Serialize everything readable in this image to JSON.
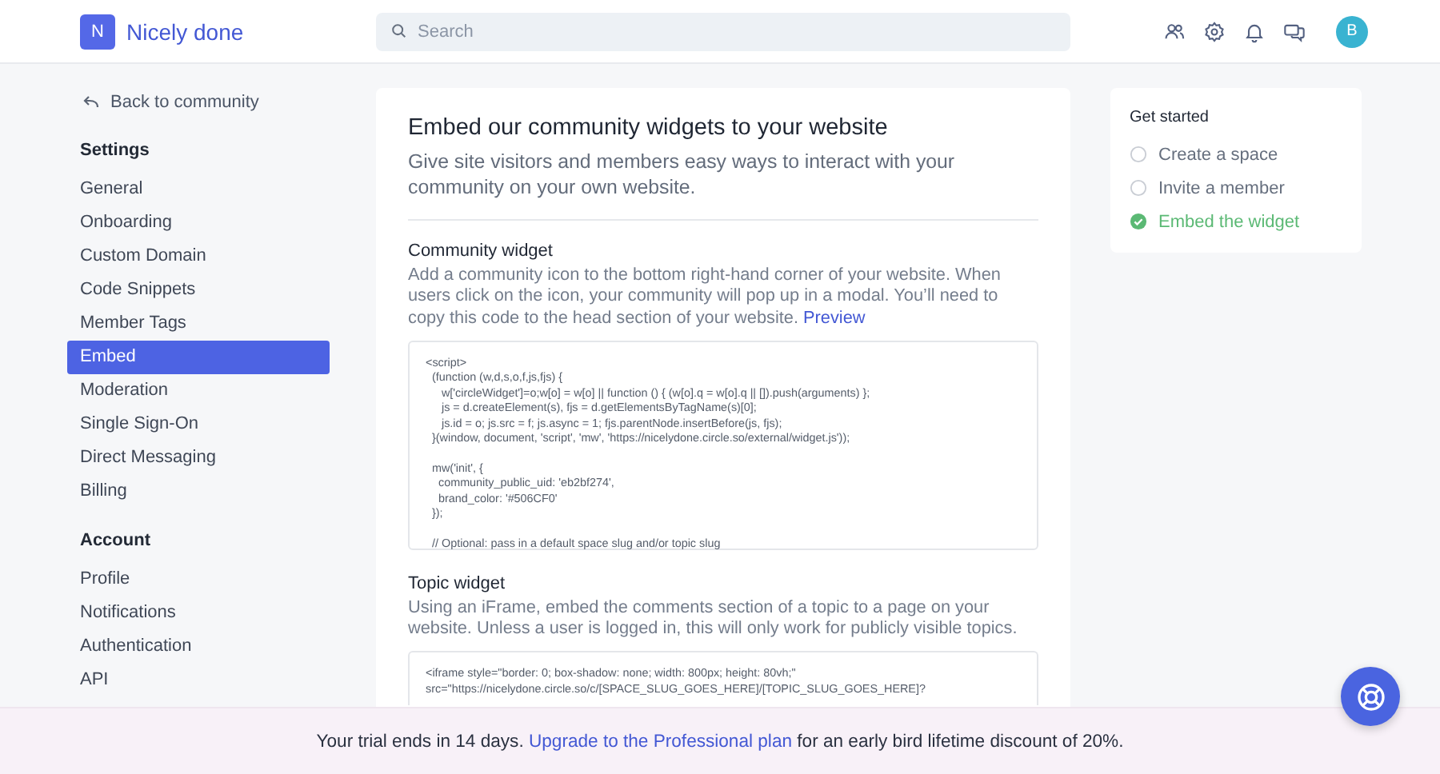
{
  "header": {
    "logo_letter": "N",
    "community_name": "Nicely done",
    "search": {
      "placeholder": "Search"
    },
    "avatar_letter": "B"
  },
  "sidebar": {
    "back_link": "Back to community",
    "groups": [
      {
        "title": "Settings",
        "items": [
          {
            "label": "General",
            "selected": false
          },
          {
            "label": "Onboarding",
            "selected": false
          },
          {
            "label": "Custom Domain",
            "selected": false
          },
          {
            "label": "Code Snippets",
            "selected": false
          },
          {
            "label": "Member Tags",
            "selected": false
          },
          {
            "label": "Embed",
            "selected": true
          },
          {
            "label": "Moderation",
            "selected": false
          },
          {
            "label": "Single Sign-On",
            "selected": false
          },
          {
            "label": "Direct Messaging",
            "selected": false
          },
          {
            "label": "Billing",
            "selected": false
          }
        ]
      },
      {
        "title": "Account",
        "items": [
          {
            "label": "Profile",
            "selected": false
          },
          {
            "label": "Notifications",
            "selected": false
          },
          {
            "label": "Authentication",
            "selected": false
          },
          {
            "label": "API",
            "selected": false
          }
        ]
      }
    ]
  },
  "main": {
    "title": "Embed our community widgets to your website",
    "subtitle": "Give site visitors and members easy ways to interact with your community on your own website.",
    "sections": [
      {
        "heading": "Community widget",
        "description": "Add a community icon to the bottom right-hand corner of your website. When users click on the icon, your community will pop up in a modal. You’ll need to copy this code to the head section of your website.",
        "link": "Preview",
        "code": [
          [
            "<script>",
            "  (function (w,d,s,o,f,js,fjs) {",
            "     w['circleWidget']=o;w[o] = w[o] || function () { (w[o].q = w[o].q || []).push(arguments) };",
            "     js = d.createElement(s), fjs = d.getElementsByTagName(s)[0];",
            "     js.id = o; js.src = f; js.async = 1; fjs.parentNode.insertBefore(js, fjs);",
            "  }(window, document, 'script', 'mw', 'https://nicelydone.circle.so/external/widget.js'));"
          ],
          [
            "  mw('init', {",
            "    community_public_uid: 'eb2bf274',",
            "    brand_color: '#506CF0'",
            "  });"
          ],
          [
            "  // Optional: pass in a default space slug and/or topic slug"
          ]
        ]
      },
      {
        "heading": "Topic widget",
        "description": "Using an iFrame, embed the comments section of a topic to a page on your website. Unless a user is logged in, this will only work for publicly visible topics.",
        "code": [
          [
            "<iframe style=\"border: 0; box-shadow: none; width: 800px; height: 80vh;\"",
            "src=\"https://nicelydone.circle.so/c/[SPACE_SLUG_GOES_HERE]/[TOPIC_SLUG_GOES_HERE]?"
          ]
        ]
      }
    ]
  },
  "checklist": {
    "title": "Get started",
    "items": [
      {
        "label": "Create a space",
        "checked": false
      },
      {
        "label": "Invite a member",
        "checked": false
      },
      {
        "label": "Embed the widget",
        "checked": true
      }
    ]
  },
  "trial_banner": {
    "text": "Your trial ends in 14 days.",
    "link": "Upgrade to the Professional plan",
    "suffix": "for an early bird lifetime discount of 20%."
  }
}
